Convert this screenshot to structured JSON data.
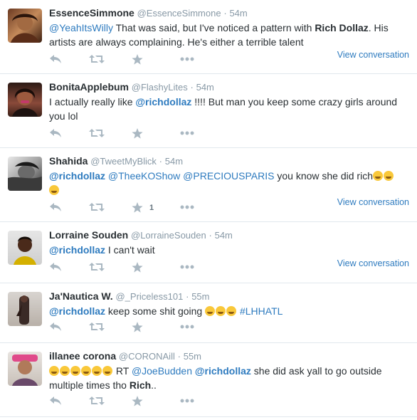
{
  "tweets": [
    {
      "fullname": "EssenceSimmone",
      "username": "@EssenceSimmone",
      "sep": "·",
      "time": "54m",
      "lines": [
        "@YeahItsWilly",
        " That was said, but I've noticed a pattern with ",
        "Rich Dollaz",
        ". His artists are always complaining. He's either a terrible talent"
      ],
      "view_conversation": "View conversation",
      "fav_count": ""
    },
    {
      "fullname": "BonitaApplebum",
      "username": "@FlashyLites",
      "sep": "·",
      "time": "54m",
      "lines": [
        "I actually really like ",
        "@richdollaz",
        " !!!! But man you keep some crazy girls around you lol"
      ],
      "view_conversation": "",
      "fav_count": ""
    },
    {
      "fullname": "Shahida",
      "username": "@TweetMyBlick",
      "sep": "·",
      "time": "54m",
      "lines": [
        "@richdollaz",
        " ",
        "@TheeKOShow",
        " ",
        "@PRECIOUSPARIS",
        " you know she did rich"
      ],
      "view_conversation": "View conversation",
      "fav_count": "1"
    },
    {
      "fullname": "Lorraine Souden",
      "username": "@LorraineSouden",
      "sep": "·",
      "time": "54m",
      "lines": [
        "@richdollaz",
        " I can't wait"
      ],
      "view_conversation": "View conversation",
      "fav_count": ""
    },
    {
      "fullname": "Ja'Nautica W.",
      "username": "@_Priceless101",
      "sep": "·",
      "time": "55m",
      "lines": [
        "@richdollaz",
        " keep some shit going ",
        "#LHHATL"
      ],
      "view_conversation": "",
      "fav_count": ""
    },
    {
      "fullname": "illanee corona",
      "username": "@CORONAill",
      "sep": "·",
      "time": "55m",
      "lines": [
        " RT ",
        "@JoeBudden",
        " ",
        "@richdollaz",
        " she did ask yall to go outside multiple times tho ",
        "Rich",
        ".."
      ],
      "view_conversation": "",
      "fav_count": ""
    }
  ],
  "icons": {
    "reply": "reply-icon",
    "retweet": "retweet-icon",
    "favorite": "star-icon",
    "more": "more-icon"
  },
  "colors": {
    "link": "#2e7bbf",
    "meta": "#8899a6",
    "action_icon": "#aab8c2",
    "border": "#e1e8ed"
  }
}
